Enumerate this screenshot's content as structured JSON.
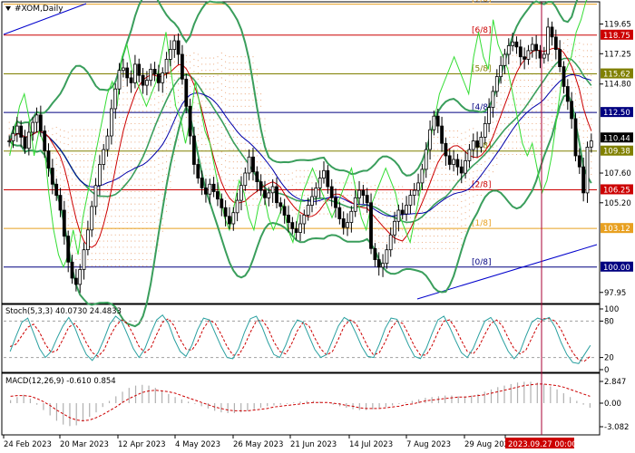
{
  "header": {
    "symbol": "#XOM,Daily",
    "stoch_label": "Stoch(5,3,3) 40.0730 24.4833",
    "macd_label": "MACD(12,26,9) -0.610 0.854"
  },
  "colors": {
    "candle": "#000000",
    "bollinger": "#3a9e5c",
    "fast_line": "#33dd33",
    "red_line": "#cc0000",
    "blue_line": "#0000aa",
    "cloud": "#e8a070",
    "murrey_orange": "#e8a020",
    "murrey_red": "#cc0000",
    "murrey_green": "#808000",
    "murrey_blue": "#000080",
    "cursor": "#aa0033",
    "stoch_main": "#2aa0a0",
    "stoch_signal": "#cc0000",
    "macd_hist": "#b0b0b0",
    "macd_signal": "#cc0000"
  },
  "chart_data": [
    {
      "type": "candlestick",
      "title": "#XOM,Daily",
      "x_tick_labels": [
        "24 Feb 2023",
        "20 Mar 2023",
        "12 Apr 2023",
        "4 May 2023",
        "26 May 2023",
        "21 Jun 2023",
        "14 Jul 2023",
        "7 Aug 2023",
        "29 Aug 2023",
        "2023.09.27 00:00"
      ],
      "y_tick_labels": [
        "119.65",
        "117.25",
        "114.80",
        "107.60",
        "105.20",
        "97.95"
      ],
      "ylim": [
        97.2,
        121.3
      ],
      "murrey_levels": [
        {
          "label": "[7/8]",
          "value": 121.25,
          "color": "#e8a020"
        },
        {
          "label": "[6/8]",
          "value": 118.75,
          "color": "#cc0000",
          "tag": "118.75"
        },
        {
          "label": "[5/8]",
          "value": 115.62,
          "color": "#808000",
          "tag": "115.62"
        },
        {
          "label": "[4/8]",
          "value": 112.5,
          "color": "#000080",
          "tag": "112.50"
        },
        {
          "label": "[3/8]",
          "value": 109.38,
          "color": "#808000",
          "tag": "109.38"
        },
        {
          "label": "[2/8]",
          "value": 106.25,
          "color": "#cc0000",
          "tag": "106.25"
        },
        {
          "label": "[1/8]",
          "value": 103.12,
          "color": "#e8a020",
          "tag": "103.12"
        },
        {
          "label": "[0/8]",
          "value": 100.0,
          "color": "#000080",
          "tag": "100.00"
        }
      ],
      "current_price": "110.44",
      "cursor_date": "2023.09.27 00:00",
      "closes": [
        110.2,
        110.8,
        111.4,
        110.5,
        109.6,
        110.9,
        111.7,
        112.3,
        111.0,
        109.4,
        108.0,
        106.7,
        105.8,
        104.6,
        102.5,
        100.4,
        99.1,
        98.6,
        99.8,
        101.4,
        103.0,
        104.9,
        106.6,
        108.3,
        109.5,
        110.6,
        112.8,
        114.4,
        115.9,
        116.1,
        115.3,
        114.9,
        116.4,
        115.5,
        114.7,
        115.1,
        116.0,
        115.6,
        114.9,
        115.7,
        116.8,
        117.6,
        118.3,
        117.2,
        115.2,
        113.0,
        110.6,
        108.3,
        107.2,
        106.4,
        105.9,
        106.7,
        106.1,
        105.5,
        104.8,
        104.1,
        103.5,
        104.4,
        105.4,
        106.6,
        107.6,
        108.9,
        107.7,
        106.9,
        106.2,
        105.6,
        106.0,
        106.5,
        105.2,
        104.9,
        104.2,
        103.6,
        103.1,
        102.8,
        103.5,
        104.2,
        105.0,
        105.7,
        106.4,
        107.2,
        107.8,
        106.5,
        105.6,
        104.8,
        103.9,
        103.2,
        103.6,
        104.5,
        105.6,
        106.2,
        105.8,
        105.2,
        101.5,
        100.6,
        100.0,
        100.3,
        101.4,
        102.6,
        103.7,
        104.6,
        104.3,
        105.0,
        105.8,
        106.2,
        106.8,
        107.9,
        109.5,
        111.1,
        112.2,
        111.4,
        110.0,
        109.0,
        108.3,
        108.7,
        108.1,
        107.6,
        108.6,
        109.5,
        110.2,
        109.7,
        110.5,
        111.6,
        112.9,
        114.2,
        115.4,
        116.3,
        117.2,
        117.9,
        118.2,
        117.8,
        117.0,
        116.8,
        117.5,
        118.0,
        117.5,
        116.9,
        117.2,
        119.4,
        118.6,
        117.6,
        116.2,
        114.6,
        113.4,
        112.0,
        109.0,
        108.1,
        106.0,
        109.7,
        110.2
      ],
      "fast_line": [
        109,
        111,
        113,
        114,
        112,
        109,
        111,
        110,
        106,
        103,
        101,
        100,
        101,
        103,
        101,
        104,
        106,
        108,
        110,
        112,
        114,
        115,
        113,
        117,
        118,
        116,
        115,
        114,
        113,
        114,
        115,
        117,
        119,
        116,
        113,
        112,
        110,
        112,
        115,
        113,
        111,
        110,
        108,
        106,
        104,
        103,
        105,
        107,
        106,
        104,
        103,
        105,
        106,
        104,
        103,
        104,
        105,
        103,
        102,
        104,
        106,
        107,
        108,
        107,
        106,
        105,
        104,
        105,
        106,
        107,
        108,
        106,
        104,
        103,
        105,
        106,
        107,
        108,
        107,
        106,
        104,
        103,
        102,
        104,
        106,
        108,
        110,
        112,
        114,
        115,
        116,
        117,
        116,
        115,
        114,
        117,
        119,
        117,
        116,
        120,
        118,
        117,
        116,
        114,
        112,
        110,
        109,
        110,
        108,
        106,
        107,
        109,
        112,
        115,
        116,
        117,
        119,
        120,
        121.5,
        122
      ]
    },
    {
      "type": "line",
      "title": "Stoch(5,3,3) 40.0730 24.4833",
      "y_tick_labels": [
        "100",
        "80",
        "20",
        "0"
      ],
      "ylim": [
        0,
        100
      ],
      "series": [
        {
          "name": "main",
          "values": [
            30,
            55,
            78,
            85,
            60,
            35,
            20,
            30,
            52,
            72,
            86,
            70,
            45,
            25,
            15,
            28,
            50,
            75,
            88,
            80,
            58,
            35,
            20,
            35,
            60,
            82,
            90,
            76,
            50,
            30,
            22,
            40,
            66,
            85,
            82,
            60,
            38,
            20,
            18,
            35,
            62,
            84,
            88,
            70,
            45,
            25,
            20,
            40,
            65,
            82,
            78,
            55,
            33,
            20,
            25,
            48,
            72,
            86,
            80,
            60,
            38,
            22,
            20,
            42,
            68,
            85,
            83,
            62,
            40,
            22,
            18,
            35,
            60,
            82,
            88,
            70,
            48,
            28,
            20,
            35,
            58,
            80,
            86,
            72,
            50,
            30,
            18,
            30,
            55,
            78,
            85,
            82,
            86,
            70,
            45,
            25,
            12,
            10,
            25,
            40
          ]
        },
        {
          "name": "signal",
          "values": [
            38,
            42,
            56,
            70,
            75,
            62,
            42,
            28,
            32,
            50,
            70,
            76,
            64,
            44,
            28,
            22,
            32,
            54,
            72,
            82,
            76,
            58,
            38,
            28,
            36,
            58,
            78,
            84,
            72,
            50,
            34,
            32,
            46,
            68,
            82,
            76,
            58,
            38,
            24,
            24,
            40,
            62,
            80,
            82,
            68,
            46,
            30,
            26,
            42,
            64,
            78,
            72,
            52,
            34,
            24,
            30,
            50,
            72,
            82,
            76,
            58,
            38,
            24,
            28,
            46,
            68,
            80,
            76,
            58,
            38,
            24,
            24,
            40,
            62,
            80,
            82,
            68,
            48,
            30,
            26,
            38,
            58,
            76,
            82,
            72,
            52,
            34,
            26,
            32,
            52,
            72,
            84,
            84,
            80,
            66,
            46,
            28,
            16,
            14,
            22
          ]
        }
      ]
    },
    {
      "type": "bar",
      "title": "MACD(12,26,9) -0.610 0.854",
      "y_tick_labels": [
        "2.847",
        "0.00",
        "-3.082"
      ],
      "ylim": [
        -3.082,
        2.847
      ],
      "series": [
        {
          "name": "histogram",
          "values": [
            0.4,
            0.8,
            1.1,
            0.6,
            -0.2,
            -0.9,
            -1.6,
            -2.3,
            -2.8,
            -3.0,
            -2.9,
            -2.4,
            -1.8,
            -1.2,
            -0.5,
            0.3,
            0.9,
            1.5,
            2.0,
            2.3,
            2.4,
            2.3,
            2.0,
            1.6,
            1.2,
            0.8,
            0.5,
            0.2,
            -0.1,
            -0.4,
            -0.7,
            -1.0,
            -1.2,
            -1.3,
            -1.3,
            -1.2,
            -1.0,
            -0.8,
            -0.6,
            -0.4,
            -0.3,
            -0.2,
            -0.1,
            0.1,
            0.2,
            0.3,
            0.3,
            0.2,
            0.0,
            -0.2,
            -0.4,
            -0.6,
            -0.8,
            -0.9,
            -0.9,
            -0.8,
            -0.7,
            -0.5,
            -0.3,
            -0.1,
            0.1,
            0.3,
            0.5,
            0.7,
            0.8,
            0.9,
            1.0,
            1.0,
            0.9,
            0.9,
            1.0,
            1.2,
            1.5,
            1.8,
            2.1,
            2.3,
            2.5,
            2.7,
            2.8,
            2.8,
            2.7,
            2.5,
            2.2,
            1.8,
            1.3,
            0.8,
            0.3,
            -0.2,
            -0.6
          ]
        },
        {
          "name": "signal",
          "values": [
            0.9,
            1.0,
            1.0,
            0.9,
            0.6,
            0.2,
            -0.3,
            -0.9,
            -1.4,
            -1.9,
            -2.2,
            -2.3,
            -2.2,
            -1.9,
            -1.5,
            -1.0,
            -0.5,
            0.1,
            0.6,
            1.0,
            1.4,
            1.6,
            1.7,
            1.6,
            1.5,
            1.3,
            1.0,
            0.7,
            0.4,
            0.1,
            -0.2,
            -0.5,
            -0.7,
            -0.9,
            -1.0,
            -1.0,
            -1.0,
            -0.9,
            -0.8,
            -0.7,
            -0.5,
            -0.4,
            -0.3,
            -0.2,
            -0.1,
            0.0,
            0.1,
            0.1,
            0.1,
            0.0,
            -0.1,
            -0.3,
            -0.4,
            -0.6,
            -0.7,
            -0.7,
            -0.7,
            -0.6,
            -0.5,
            -0.4,
            -0.2,
            -0.1,
            0.1,
            0.3,
            0.4,
            0.5,
            0.6,
            0.7,
            0.8,
            0.8,
            0.9,
            1.0,
            1.1,
            1.3,
            1.5,
            1.7,
            1.9,
            2.1,
            2.3,
            2.4,
            2.5,
            2.5,
            2.4,
            2.3,
            2.1,
            1.8,
            1.5,
            1.2,
            0.9
          ]
        }
      ]
    }
  ]
}
